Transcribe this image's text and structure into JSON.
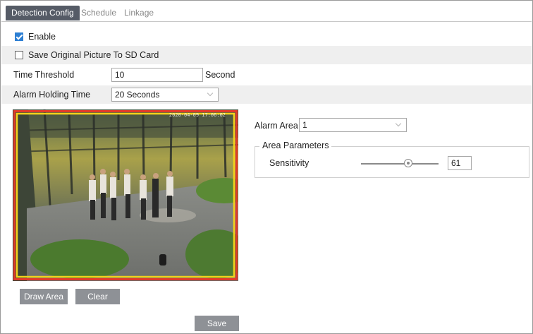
{
  "tabs": [
    {
      "label": "Detection Config",
      "active": true
    },
    {
      "label": "Schedule",
      "active": false
    },
    {
      "label": "Linkage",
      "active": false
    }
  ],
  "enable": {
    "label": "Enable",
    "checked": true
  },
  "save_picture": {
    "label": "Save Original Picture To SD Card",
    "checked": false
  },
  "time_threshold": {
    "label": "Time Threshold",
    "value": "10",
    "unit": "Second"
  },
  "alarm_holding": {
    "label": "Alarm Holding Time",
    "value": "20 Seconds"
  },
  "video": {
    "osd_time": "2020-04-09 17:06:02"
  },
  "buttons": {
    "draw_area": "Draw Area",
    "clear": "Clear",
    "save": "Save"
  },
  "alarm_area": {
    "label": "Alarm Area",
    "value": "1"
  },
  "area_params": {
    "title": "Area Parameters",
    "sensitivity_label": "Sensitivity",
    "sensitivity_value": "61",
    "sensitivity_fraction": 0.61
  },
  "colors": {
    "tab_active": "#555b66",
    "checkbox": "#2d7fd3",
    "button": "#8e9196",
    "area_border": "#f2d21b",
    "area_outer": "#e23a2a"
  }
}
